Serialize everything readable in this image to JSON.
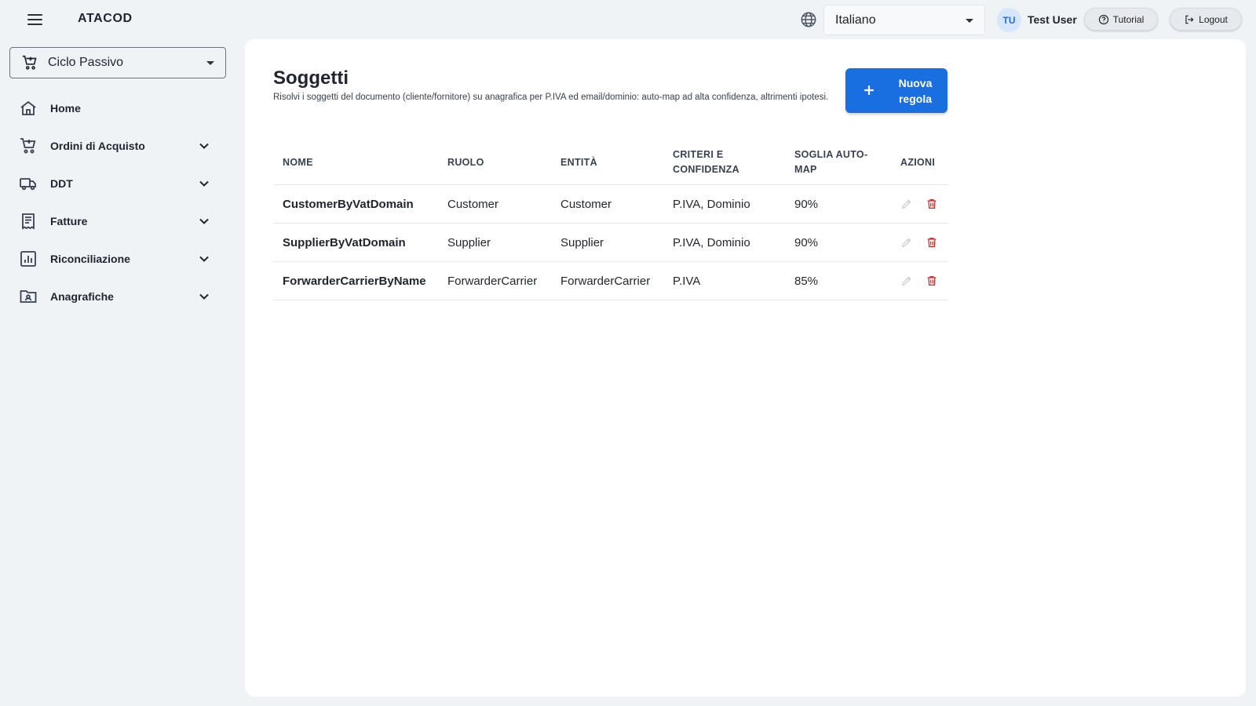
{
  "header": {
    "app_title": "ATACOD",
    "language": "Italiano",
    "user_initials": "TU",
    "user_name": "Test User",
    "tutorial_label": "Tutorial",
    "logout_label": "Logout"
  },
  "sidebar": {
    "mode": "Ciclo Passivo",
    "items": [
      {
        "label": "Home",
        "icon": "home-icon",
        "expandable": false
      },
      {
        "label": "Ordini di Acquisto",
        "icon": "cart-icon",
        "expandable": true
      },
      {
        "label": "DDT",
        "icon": "truck-icon",
        "expandable": true
      },
      {
        "label": "Fatture",
        "icon": "receipt-icon",
        "expandable": true
      },
      {
        "label": "Riconciliazione",
        "icon": "chart-icon",
        "expandable": true
      },
      {
        "label": "Anagrafiche",
        "icon": "contact-folder-icon",
        "expandable": true
      }
    ]
  },
  "main": {
    "title": "Soggetti",
    "description": "Risolvi i soggetti del documento (cliente/fornitore) su anagrafica per P.IVA ed email/dominio: auto-map ad alta confidenza, altrimenti ipotesi.",
    "new_rule_label": "Nuova regola",
    "table": {
      "headers": [
        "NOME",
        "RUOLO",
        "ENTITÀ",
        "CRITERI E CONFIDENZA",
        "SOGLIA AUTO-MAP",
        "AZIONI"
      ],
      "rows": [
        [
          "CustomerByVatDomain",
          "Customer",
          "Customer",
          "P.IVA, Dominio",
          "90%"
        ],
        [
          "SupplierByVatDomain",
          "Supplier",
          "Supplier",
          "P.IVA, Dominio",
          "90%"
        ],
        [
          "ForwarderCarrierByName",
          "ForwarderCarrier",
          "ForwarderCarrier",
          "P.IVA",
          "85%"
        ]
      ]
    }
  },
  "colors": {
    "accent": "#1a6fe0",
    "delete": "#d32f2f",
    "background": "#f0f3f6"
  }
}
